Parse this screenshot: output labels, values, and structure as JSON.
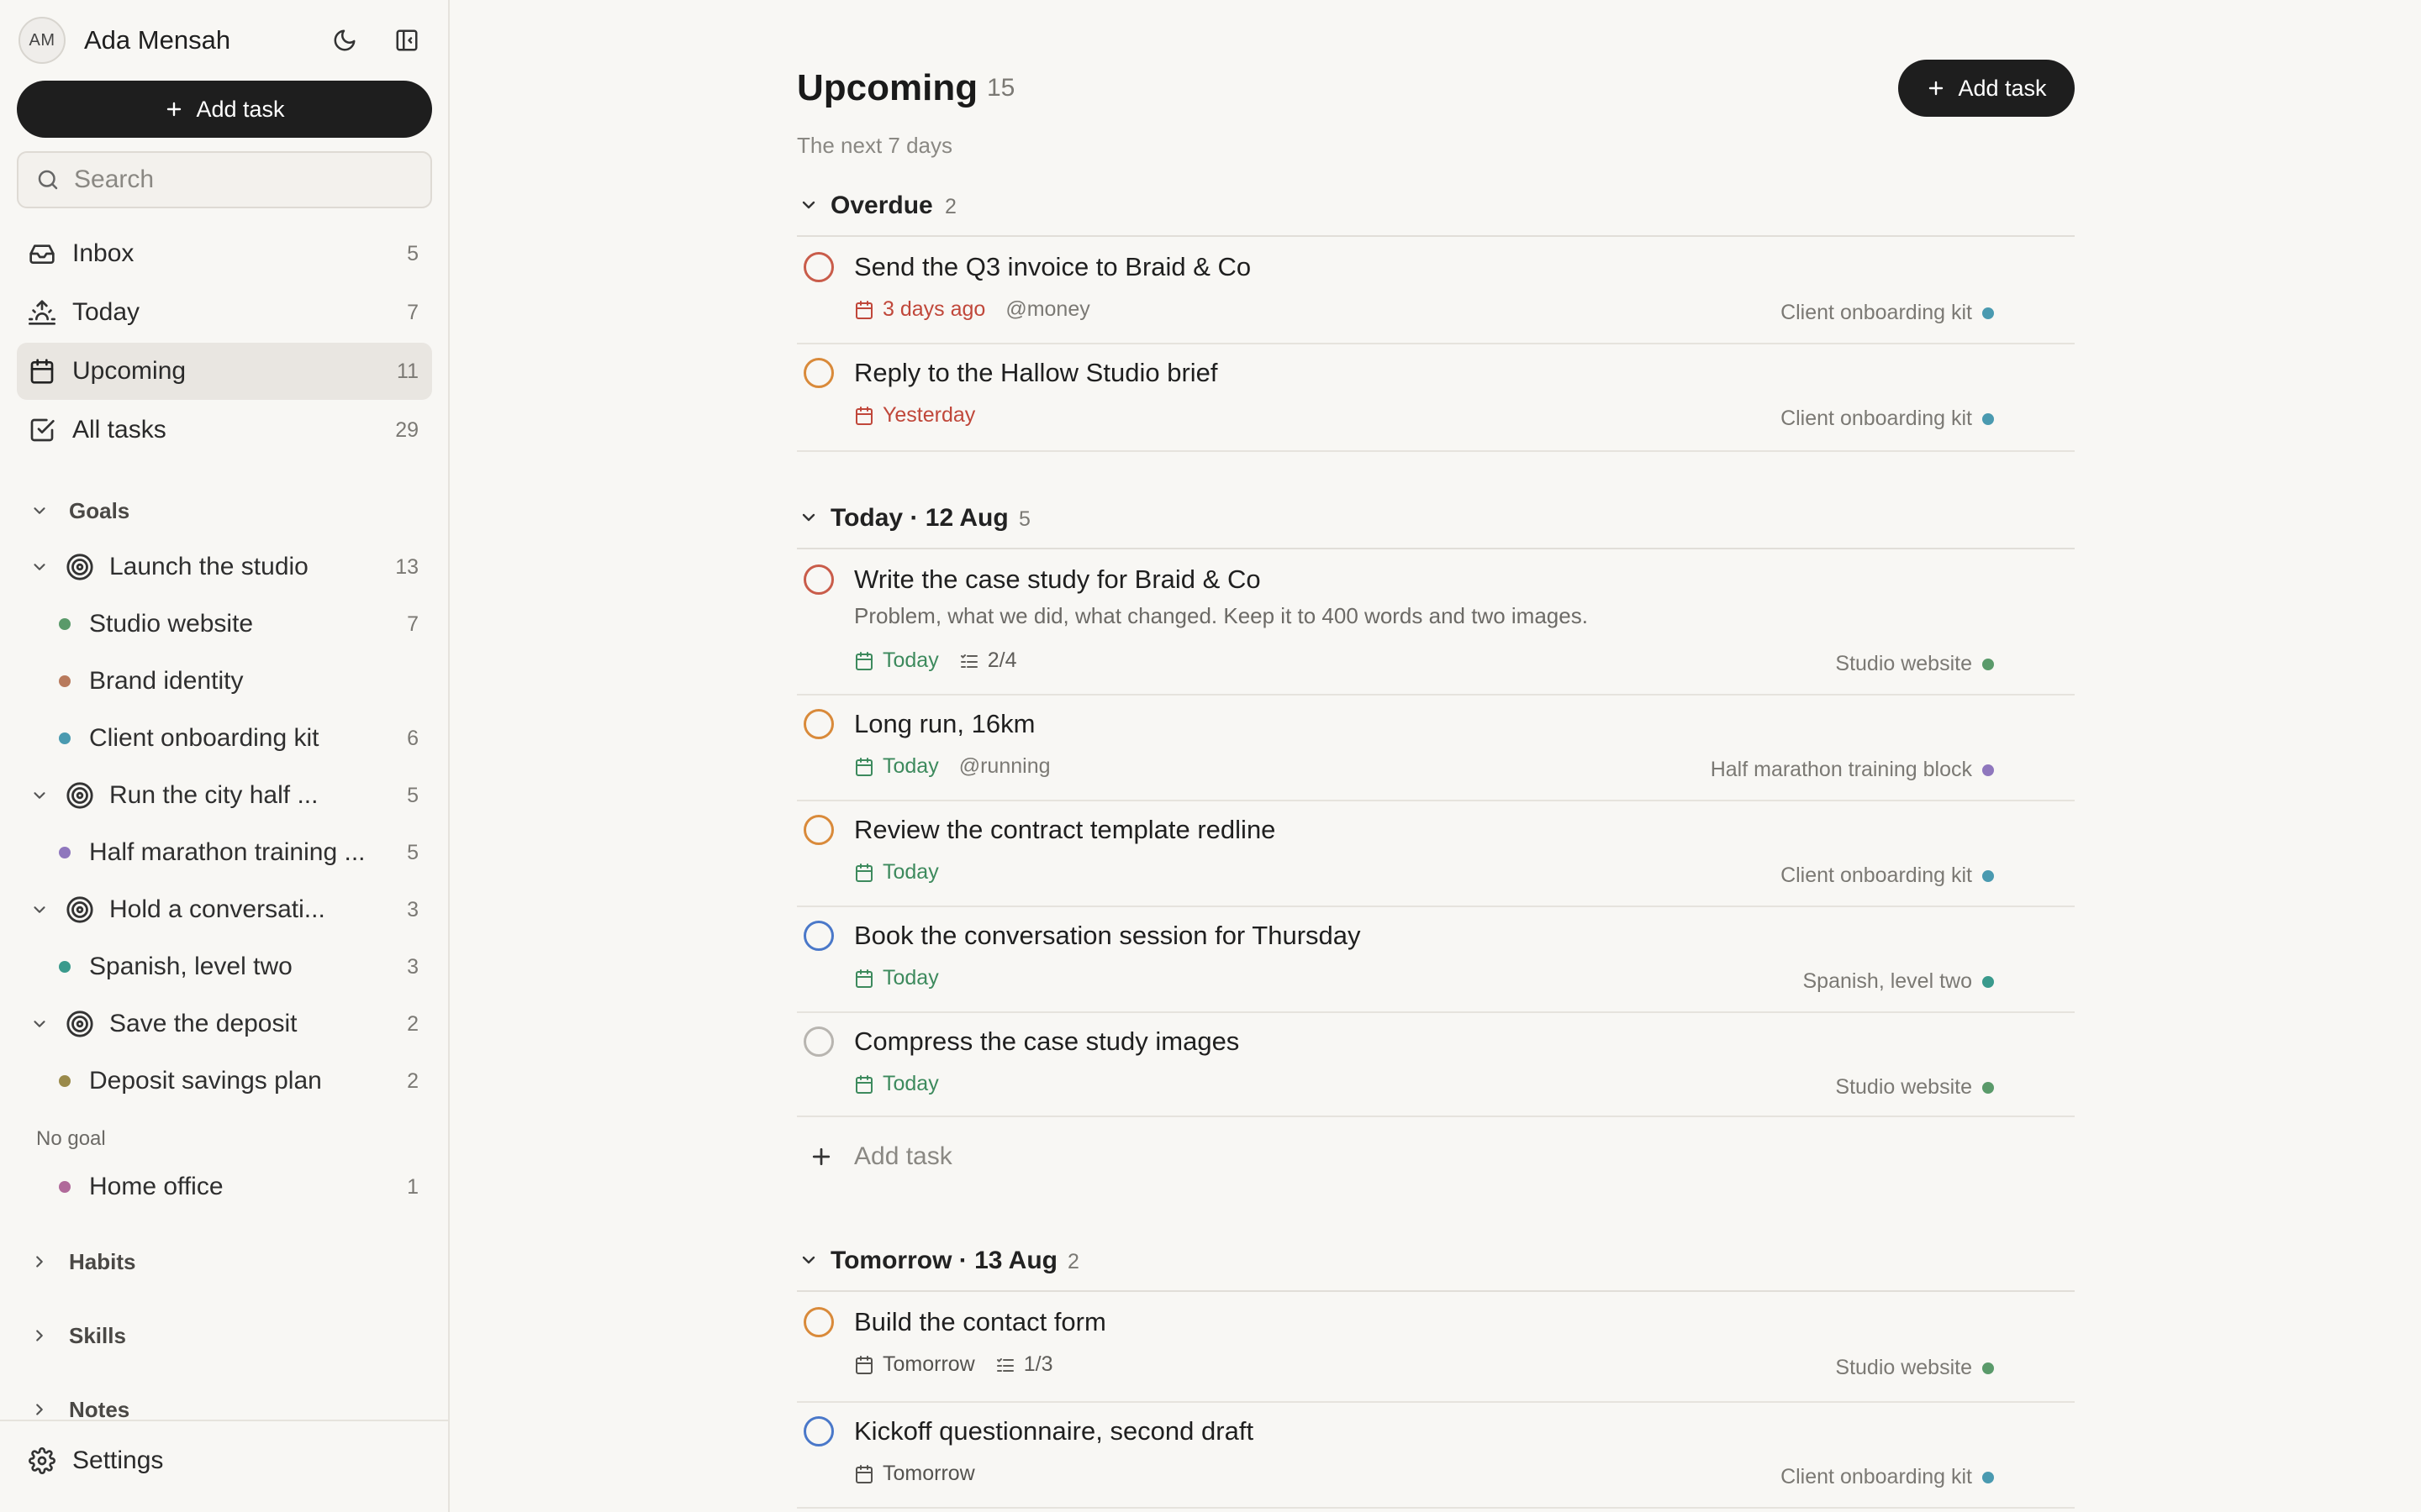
{
  "user": {
    "initials": "AM",
    "name": "Ada Mensah"
  },
  "sidebar": {
    "add_task_label": "Add task",
    "search_placeholder": "Search",
    "nav": [
      {
        "label": "Inbox",
        "count": "5",
        "icon": "inbox-icon"
      },
      {
        "label": "Today",
        "count": "7",
        "icon": "sunrise-icon"
      },
      {
        "label": "Upcoming",
        "count": "11",
        "icon": "calendar-icon",
        "active": true
      },
      {
        "label": "All tasks",
        "count": "29",
        "icon": "check-square-icon"
      }
    ],
    "goals_label": "Goals",
    "goals": [
      {
        "label": "Launch the studio",
        "count": "13",
        "projects": [
          {
            "label": "Studio website",
            "count": "7",
            "color": "#5a9a6a"
          },
          {
            "label": "Brand identity",
            "count": "",
            "color": "#b87a5c"
          },
          {
            "label": "Client onboarding kit",
            "count": "6",
            "color": "#4a9ab0"
          }
        ]
      },
      {
        "label": "Run the city half ...",
        "count": "5",
        "projects": [
          {
            "label": "Half marathon training ...",
            "count": "5",
            "color": "#8f77bd"
          }
        ]
      },
      {
        "label": "Hold a conversati...",
        "count": "3",
        "projects": [
          {
            "label": "Spanish, level two",
            "count": "3",
            "color": "#3a9a8c"
          }
        ]
      },
      {
        "label": "Save the deposit",
        "count": "2",
        "projects": [
          {
            "label": "Deposit savings plan",
            "count": "2",
            "color": "#9a8a4a"
          }
        ]
      }
    ],
    "no_goal_label": "No goal",
    "no_goal_projects": [
      {
        "label": "Home office",
        "count": "1",
        "color": "#b06a9a"
      }
    ],
    "habits_label": "Habits",
    "skills_label": "Skills",
    "notes_label": "Notes",
    "settings_label": "Settings"
  },
  "main": {
    "title": "Upcoming",
    "count": "15",
    "subtitle": "The next 7 days",
    "add_task_label": "Add task",
    "inline_add_label": "Add task",
    "groups": [
      {
        "title": "Overdue",
        "count": "2",
        "tasks": [
          {
            "title": "Send the Q3 invoice to Braid & Co",
            "date": "3 days ago",
            "tag": "@money",
            "project": "Client onboarding kit"
          },
          {
            "title": "Reply to the Hallow Studio brief",
            "date": "Yesterday",
            "project": "Client onboarding kit"
          }
        ]
      },
      {
        "title": "Today · 12 Aug",
        "count": "5",
        "tasks": [
          {
            "title": "Write the case study for Braid & Co",
            "description": "Problem, what we did, what changed. Keep it to 400 words and two images.",
            "date": "Today",
            "subtasks": "2/4",
            "project": "Studio website"
          },
          {
            "title": "Long run, 16km",
            "date": "Today",
            "tag": "@running",
            "project": "Half marathon training block"
          },
          {
            "title": "Review the contract template redline",
            "date": "Today",
            "project": "Client onboarding kit"
          },
          {
            "title": "Book the conversation session for Thursday",
            "date": "Today",
            "project": "Spanish, level two"
          },
          {
            "title": "Compress the case study images",
            "date": "Today",
            "project": "Studio website"
          }
        ]
      },
      {
        "title": "Tomorrow · 13 Aug",
        "count": "2",
        "tasks": [
          {
            "title": "Build the contact form",
            "date": "Tomorrow",
            "subtasks": "1/3",
            "project": "Studio website"
          },
          {
            "title": "Kickoff questionnaire, second draft",
            "date": "Tomorrow",
            "project": "Client onboarding kit"
          }
        ]
      }
    ]
  },
  "colors": {
    "overdue": "#c0473a",
    "today": "#3d8a5d",
    "priority_red": "#c95c4a",
    "priority_orange": "#d98a3a",
    "priority_blue": "#4a78c9",
    "priority_none": "#b8b5b0",
    "project_studio_website": "#5a9a6a",
    "project_client_onboarding": "#4a9ab0",
    "project_half_marathon": "#8f77bd",
    "project_spanish": "#3a9a8c"
  }
}
